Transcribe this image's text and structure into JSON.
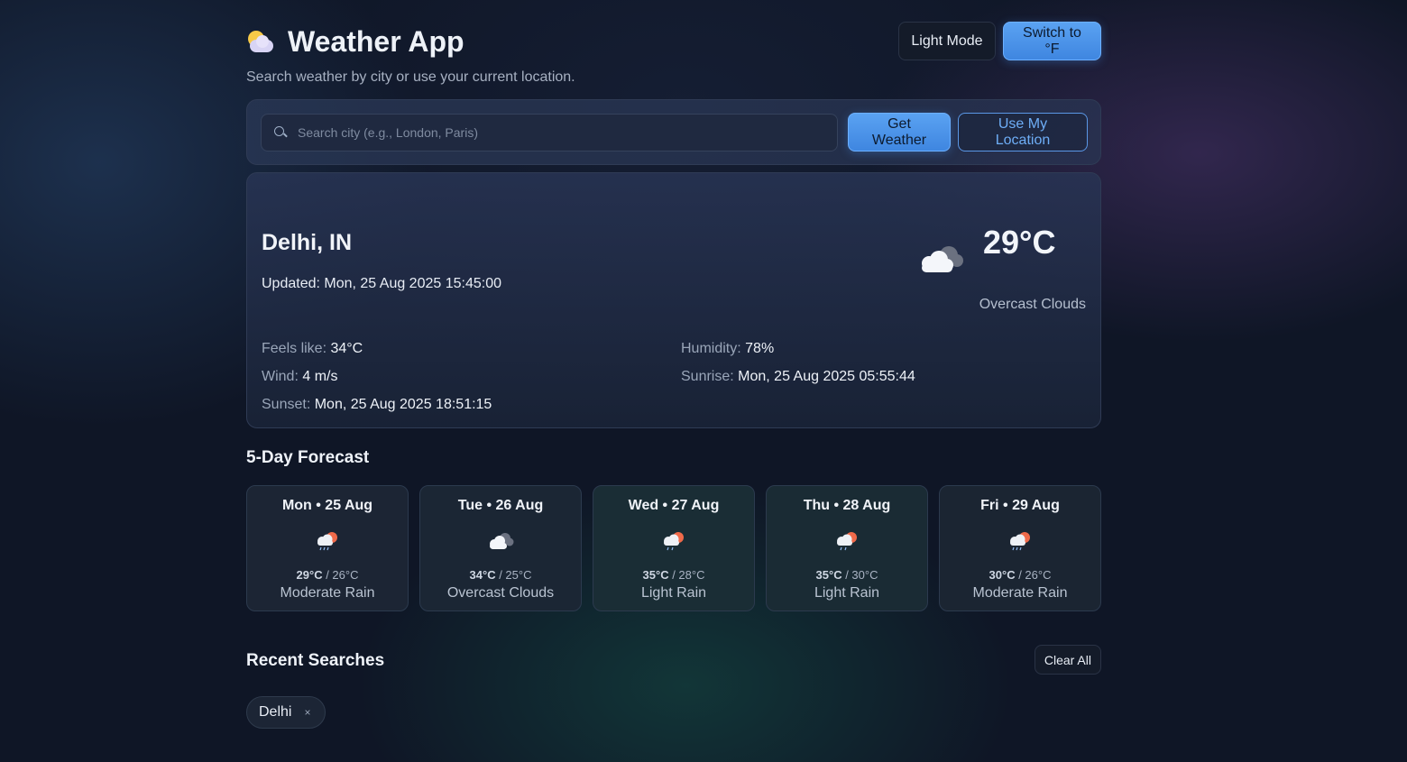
{
  "header": {
    "title": "Weather App",
    "subtitle": "Search weather by city or use your current location.",
    "theme_toggle_label": "Light Mode",
    "unit_toggle_label": "Switch to °F"
  },
  "search": {
    "placeholder": "Search city (e.g., London, Paris)",
    "value": "",
    "get_weather_label": "Get Weather",
    "use_location_label": "Use My Location"
  },
  "current": {
    "city": "Delhi, IN",
    "updated_label": "Updated:",
    "updated_value": "Mon, 25 Aug 2025 15:45:00",
    "temperature": "29°C",
    "condition": "Overcast Clouds",
    "condition_icon": "overcast-clouds-icon",
    "details": {
      "feels_like_label": "Feels like:",
      "feels_like_value": "34°C",
      "humidity_label": "Humidity:",
      "humidity_value": "78%",
      "wind_label": "Wind:",
      "wind_value": "4 m/s",
      "sunrise_label": "Sunrise:",
      "sunrise_value": "Mon, 25 Aug 2025 05:55:44",
      "sunset_label": "Sunset:",
      "sunset_value": "Mon, 25 Aug 2025 18:51:15"
    }
  },
  "forecast": {
    "title": "5-Day Forecast",
    "days": [
      {
        "day": "Mon • 25 Aug",
        "hi": "29°C",
        "lo": "26°C",
        "desc": "Moderate Rain",
        "icon": "rain-icon",
        "bg": "#1c2534"
      },
      {
        "day": "Tue • 26 Aug",
        "hi": "34°C",
        "lo": "25°C",
        "desc": "Overcast Clouds",
        "icon": "overcast-clouds-icon",
        "bg": "#1b2634"
      },
      {
        "day": "Wed • 27 Aug",
        "hi": "35°C",
        "lo": "28°C",
        "desc": "Light Rain",
        "icon": "rain-icon",
        "bg": "#1a2d35"
      },
      {
        "day": "Thu • 28 Aug",
        "hi": "35°C",
        "lo": "30°C",
        "desc": "Light Rain",
        "icon": "rain-icon",
        "bg": "#1a2b34"
      },
      {
        "day": "Fri • 29 Aug",
        "hi": "30°C",
        "lo": "26°C",
        "desc": "Moderate Rain",
        "icon": "rain-icon",
        "bg": "#1b2532"
      }
    ]
  },
  "recent": {
    "title": "Recent Searches",
    "clear_label": "Clear All",
    "items": [
      {
        "label": "Delhi",
        "remove": "×"
      }
    ]
  },
  "colors": {
    "background": "#0f1626",
    "accent": "#4a92e8",
    "card": "#202b42"
  }
}
